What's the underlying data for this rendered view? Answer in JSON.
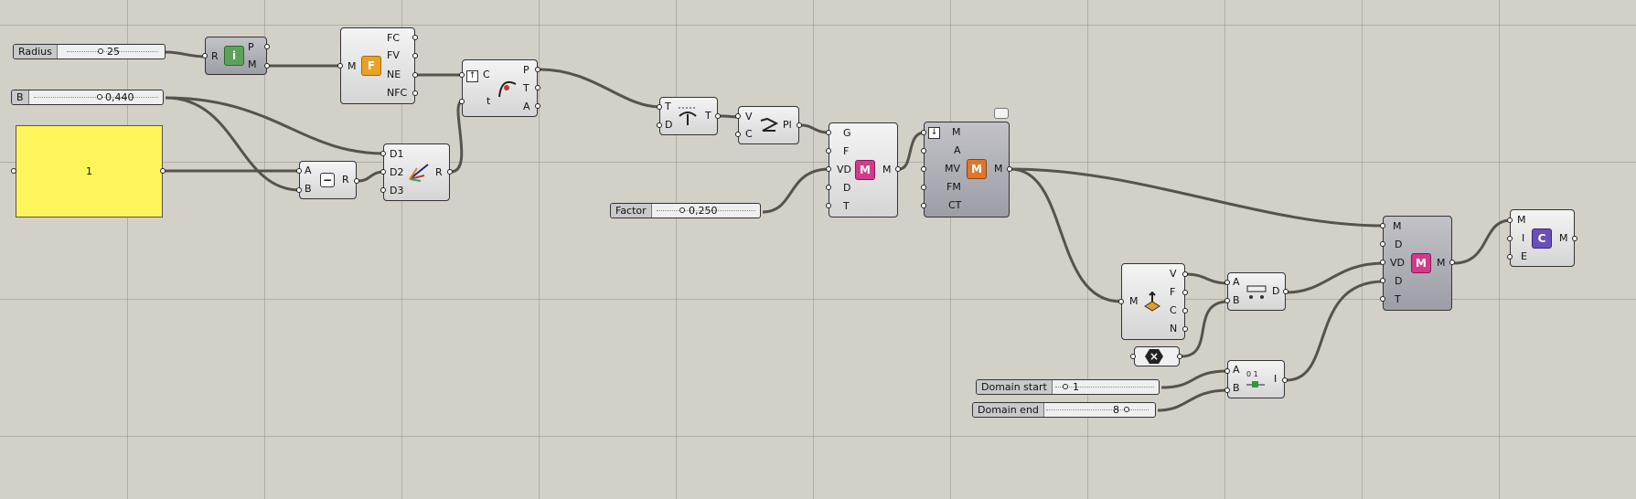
{
  "sliders": {
    "radius": {
      "label": "Radius",
      "value": "25"
    },
    "b": {
      "label": "B",
      "value": "0,440"
    },
    "factor": {
      "label": "Factor",
      "value": "0,250"
    },
    "domain_start": {
      "label": "Domain start",
      "value": "1"
    },
    "domain_end": {
      "label": "Domain end",
      "value": "8"
    }
  },
  "panel": {
    "value": "1"
  },
  "components": {
    "platonic": {
      "inputs": [
        "R"
      ],
      "outputs": [
        "P",
        "M"
      ],
      "icon": "icosahedron-icon",
      "color": "#5ea15d"
    },
    "faces": {
      "inputs": [
        "M"
      ],
      "outputs": [
        "FC",
        "FV",
        "NE",
        "NFC"
      ],
      "icon": "face-split-icon",
      "color": "#e8a224"
    },
    "subtract": {
      "inputs": [
        "A",
        "B"
      ],
      "outputs": [
        "R"
      ],
      "icon": "minus-icon"
    },
    "construct": {
      "inputs": [
        "D1",
        "D2",
        "D3"
      ],
      "outputs": [
        "R"
      ],
      "icon": "vector-arrows-icon"
    },
    "eval_curve": {
      "inputs": [
        "C",
        "t"
      ],
      "outputs": [
        "P",
        "T",
        "A"
      ],
      "icon": "evaluate-curve-icon"
    },
    "project": {
      "inputs": [
        "T",
        "D"
      ],
      "outputs": [
        "T"
      ],
      "icon": "palm-tree-icon"
    },
    "polyline": {
      "inputs": [
        "V",
        "C"
      ],
      "outputs": [
        "Pl"
      ],
      "icon": "polyline-icon"
    },
    "mesh_map1": {
      "inputs": [
        "G",
        "F",
        "VD",
        "D",
        "T"
      ],
      "outputs": [
        "M"
      ],
      "icon": "mesh-transform-icon",
      "color": "#d13c8a"
    },
    "mesh_combine": {
      "inputs": [
        "M",
        "A",
        "MV",
        "FM",
        "CT"
      ],
      "outputs": [
        "M"
      ],
      "icon": "mesh-combine-icon",
      "color": "#e0762a"
    },
    "deconstruct": {
      "inputs": [
        "M"
      ],
      "outputs": [
        "V",
        "F",
        "C",
        "N"
      ],
      "icon": "deconstruct-mesh-icon"
    },
    "distance": {
      "inputs": [
        "A",
        "B"
      ],
      "outputs": [
        "D"
      ],
      "icon": "ruler-icon"
    },
    "negate": {
      "icon": "negate-icon",
      "label": "×"
    },
    "series": {
      "inputs": [
        "A",
        "B"
      ],
      "outputs": [
        "I"
      ],
      "icon": "range-icon"
    },
    "mesh_map2": {
      "inputs": [
        "M",
        "D",
        "VD",
        "D",
        "T"
      ],
      "outputs": [
        "M"
      ],
      "icon": "mesh-transform-icon",
      "color": "#d13c8a"
    },
    "mesh_color": {
      "inputs": [
        "M",
        "I",
        "E"
      ],
      "outputs": [
        "M"
      ],
      "icon": "mesh-color-icon",
      "color": "#6a4fb8"
    }
  },
  "colors": {
    "canvas": "#d3d0c8",
    "wire": "#55524c",
    "panel": "#fff55a"
  }
}
